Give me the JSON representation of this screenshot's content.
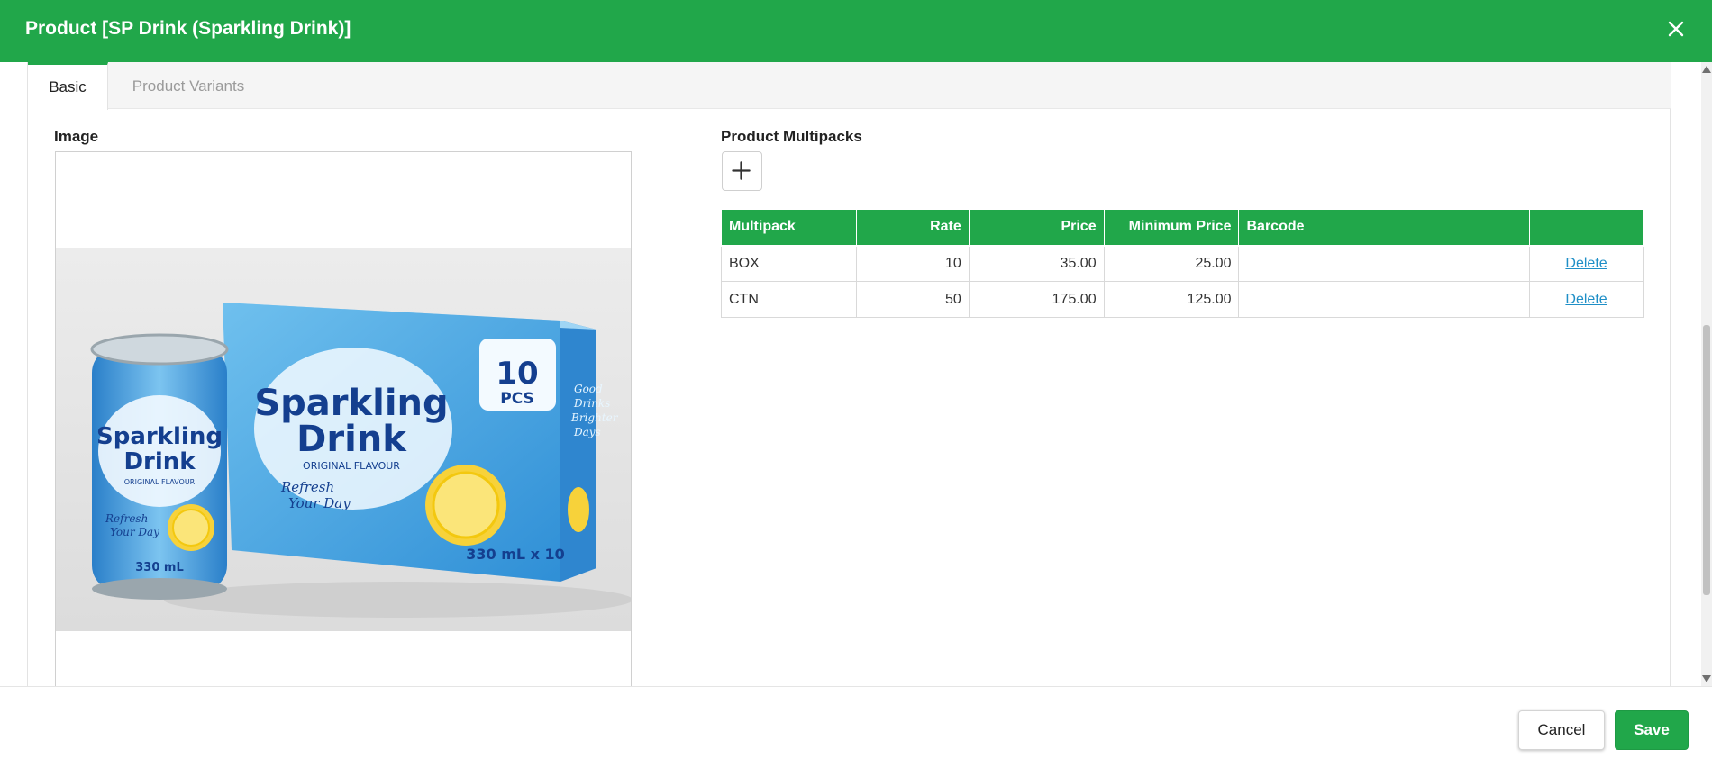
{
  "window": {
    "title": "Product [SP Drink (Sparkling Drink)]"
  },
  "tabs": [
    {
      "label": "Basic",
      "active": true
    },
    {
      "label": "Product Variants",
      "active": false
    }
  ],
  "image_section": {
    "label": "Image",
    "picture": {
      "can_brand": "Sparkling",
      "can_brand2": "Drink",
      "can_flavour": "ORIGINAL FLAVOUR",
      "can_tagline1": "Refresh",
      "can_tagline2": "Your Day",
      "can_volume": "330 mL",
      "box_brand": "Sparkling",
      "box_brand2": "Drink",
      "box_flavour": "ORIGINAL FLAVOUR",
      "box_tagline1": "Refresh",
      "box_tagline2": "Your Day",
      "box_count": "10",
      "box_count_unit": "PCS",
      "box_pack": "330 mL x 10",
      "box_side1": "Good",
      "box_side2": "Drinks",
      "box_side3": "Brighter",
      "box_side4": "Days"
    }
  },
  "multipacks": {
    "label": "Product Multipacks",
    "add_icon": "plus-icon",
    "columns": [
      "Multipack",
      "Rate",
      "Price",
      "Minimum Price",
      "Barcode",
      ""
    ],
    "rows": [
      {
        "multipack": "BOX",
        "rate": "10",
        "price": "35.00",
        "min_price": "25.00",
        "barcode": "",
        "action": "Delete"
      },
      {
        "multipack": "CTN",
        "rate": "50",
        "price": "175.00",
        "min_price": "125.00",
        "barcode": "",
        "action": "Delete"
      }
    ]
  },
  "footer": {
    "cancel_label": "Cancel",
    "save_label": "Save"
  },
  "colors": {
    "accent": "#21a74a",
    "link": "#1f8fc7"
  }
}
